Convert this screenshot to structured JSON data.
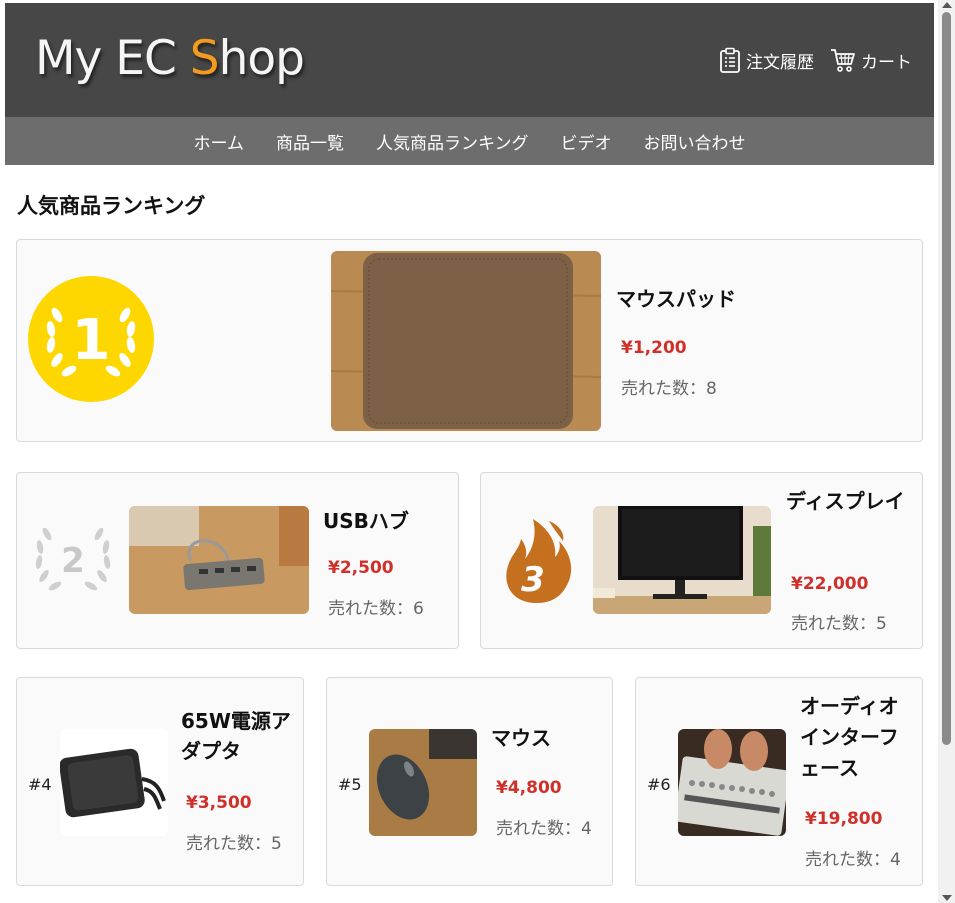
{
  "header": {
    "logo_main": "My EC ",
    "logo_accent": "S",
    "logo_rest": "hop",
    "order_history_label": "注文履歴",
    "cart_label": "カート"
  },
  "nav": {
    "items": [
      "ホーム",
      "商品一覧",
      "人気商品ランキング",
      "ビデオ",
      "お問い合わせ"
    ]
  },
  "page_title": "人気商品ランキング",
  "ranking": [
    {
      "rank": "1",
      "name": "マウスパッド",
      "price": "¥1,200",
      "sold": "売れた数：8"
    },
    {
      "rank": "2",
      "name": "USBハブ",
      "price": "¥2,500",
      "sold": "売れた数：6"
    },
    {
      "rank": "3",
      "name": "ディスプレイ",
      "price": "¥22,000",
      "sold": "売れた数：5"
    },
    {
      "rank": "#4",
      "name": "65W電源アダプタ",
      "price": "¥3,500",
      "sold": "売れた数：5"
    },
    {
      "rank": "#5",
      "name": "マウス",
      "price": "¥4,800",
      "sold": "売れた数：4"
    },
    {
      "rank": "#6",
      "name": "オーディオインターフェース",
      "price": "¥19,800",
      "sold": "売れた数：4"
    }
  ],
  "colors": {
    "header_bg": "#474747",
    "nav_bg": "#6d6d6d",
    "accent": "#f39b1e",
    "price": "#d0302a",
    "gold": "#ffd700",
    "silver": "#c8c8c8",
    "bronze": "#c5701f"
  }
}
